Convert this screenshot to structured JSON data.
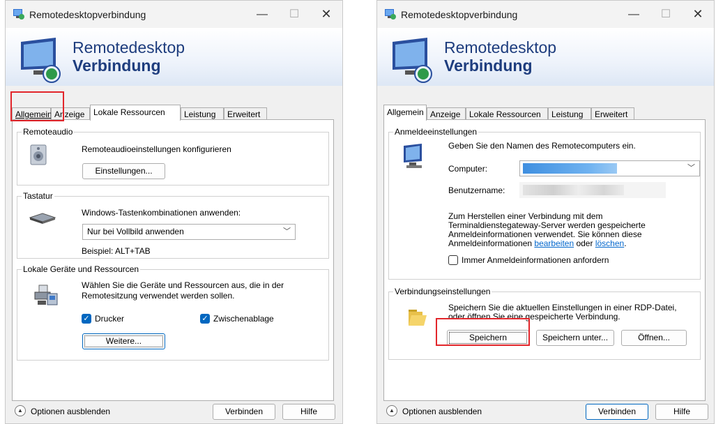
{
  "windows": [
    {
      "title": "Remotedesktopverbindung",
      "banner_line1": "Remotedesktop",
      "banner_line2": "Verbindung",
      "tabs": [
        "Allgemein",
        "Anzeige",
        "Lokale Ressourcen",
        "Leistung",
        "Erweitert"
      ],
      "selected_tab": "Lokale Ressourcen",
      "remoteaudio": {
        "label": "Remoteaudio",
        "text": "Remoteaudioeinstellungen konfigurieren",
        "button": "Einstellungen..."
      },
      "tastatur": {
        "label": "Tastatur",
        "text": "Windows-Tastenkombinationen anwenden:",
        "select_value": "Nur bei Vollbild anwenden",
        "example": "Beispiel: ALT+TAB"
      },
      "geraete": {
        "label": "Lokale Geräte und Ressourcen",
        "text_line1": "Wählen Sie die Geräte und Ressourcen aus, die in der",
        "text_line2": "Remotesitzung verwendet werden sollen.",
        "cb_drucker": "Drucker",
        "cb_zwischenablage": "Zwischenablage",
        "button": "Weitere..."
      },
      "options_label": "Optionen ausblenden",
      "connect_button": "Verbinden",
      "help_button": "Hilfe"
    },
    {
      "title": "Remotedesktopverbindung",
      "banner_line1": "Remotedesktop",
      "banner_line2": "Verbindung",
      "tabs": [
        "Allgemein",
        "Anzeige",
        "Lokale Ressourcen",
        "Leistung",
        "Erweitert"
      ],
      "selected_tab": "Allgemein",
      "anmelde": {
        "label": "Anmeldeeinstellungen",
        "intro": "Geben Sie den Namen des Remotecomputers ein.",
        "computer_label": "Computer:",
        "user_label": "Benutzername:",
        "info_line1": "Zum Herstellen einer Verbindung mit dem",
        "info_line2": "Terminaldienstegateway-Server werden gespeicherte",
        "info_line3": "Anmeldeinformationen verwendet. Sie können diese",
        "info_line4_a": "Anmeldeinformationen ",
        "info_link1": "bearbeiten",
        "info_line4_b": " oder ",
        "info_link2": "löschen",
        "info_line4_c": ".",
        "checkbox": "Immer Anmeldeinformationen anfordern"
      },
      "verbindung": {
        "label": "Verbindungseinstellungen",
        "text_line1": "Speichern Sie die aktuellen Einstellungen in einer RDP-Datei,",
        "text_line2": "oder öffnen Sie eine gespeicherte Verbindung.",
        "btn_save": "Speichern",
        "btn_save_as": "Speichern unter...",
        "btn_open": "Öffnen..."
      },
      "options_label": "Optionen ausblenden",
      "connect_button": "Verbinden",
      "help_button": "Hilfe"
    }
  ],
  "colors": {
    "highlight": "#e2262b",
    "accent": "#0067c0",
    "banner_text": "#1e3d7e"
  }
}
